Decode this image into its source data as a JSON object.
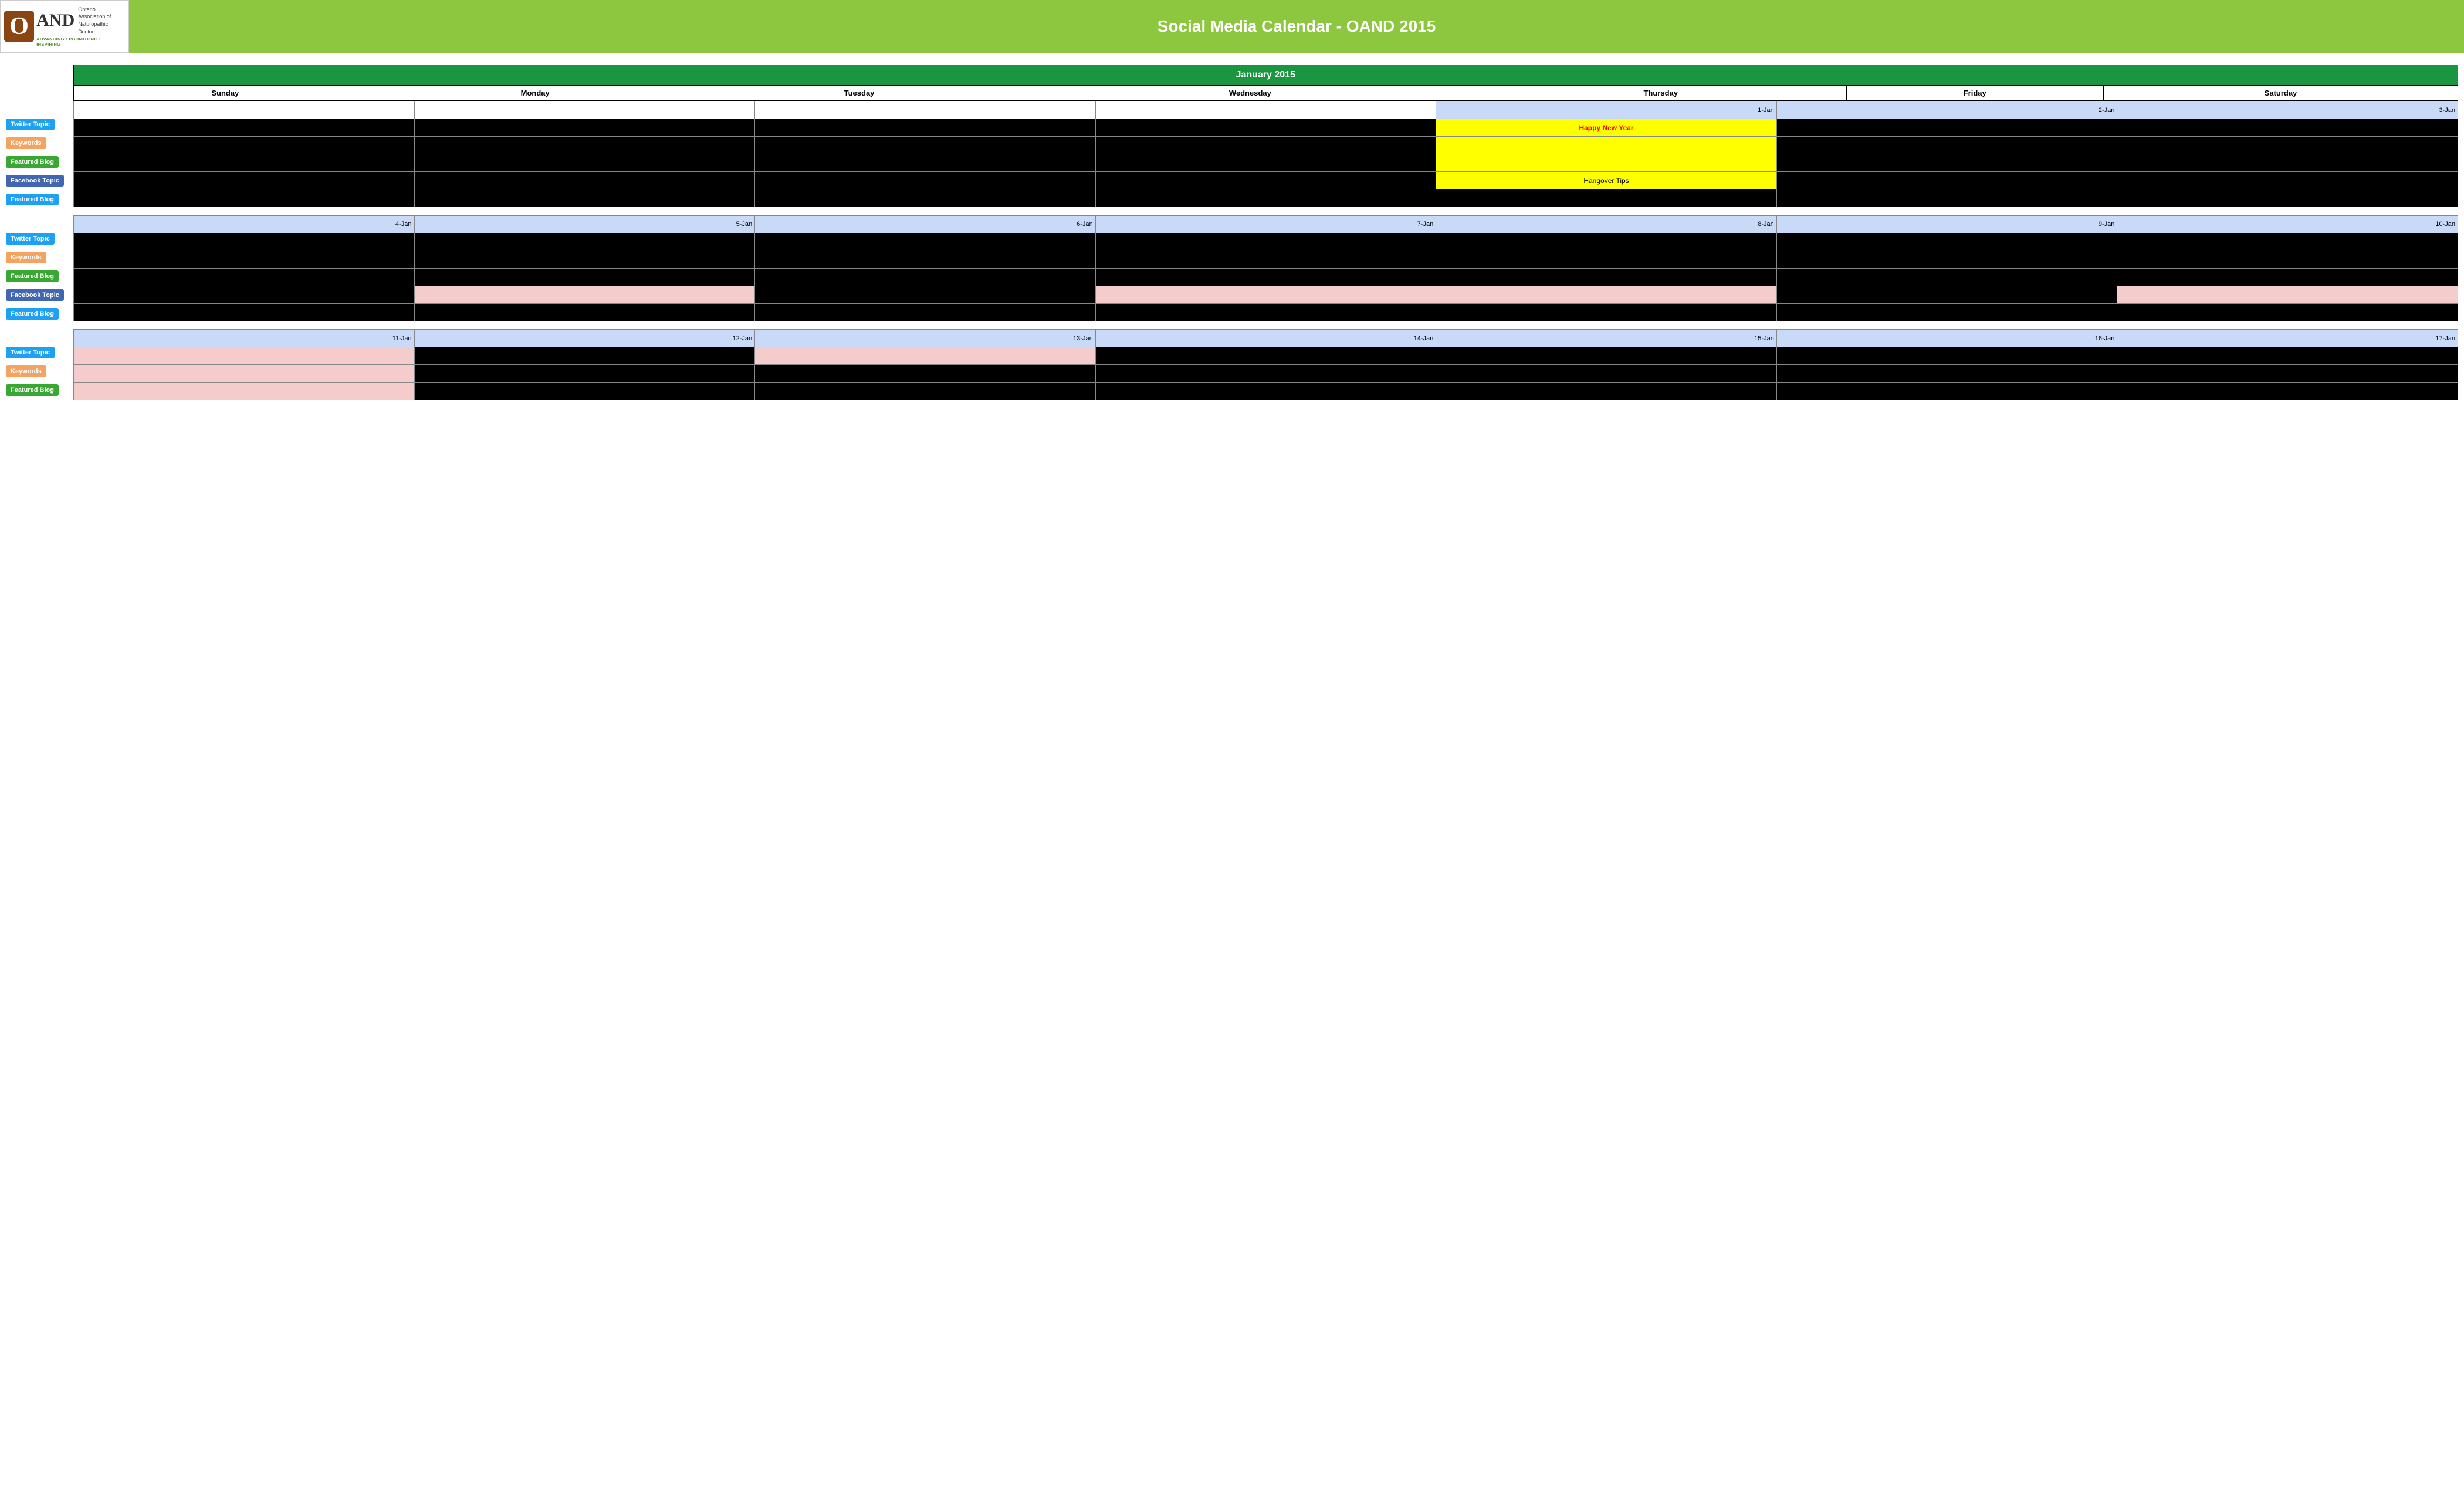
{
  "header": {
    "logo": {
      "o_letter": "O",
      "and_text": "AND",
      "side_text_line1": "Ontario",
      "side_text_line2": "Association of",
      "side_text_line3": "Naturopathic",
      "side_text_line4": "Doctors",
      "tagline": "ADVANCING • PROMOTING • INSPIRING"
    },
    "title": "Social Media Calendar - OAND 2015"
  },
  "calendar": {
    "month": "January 2015",
    "day_headers": [
      "Sunday",
      "Monday",
      "Tuesday",
      "Wednesday",
      "Thursday",
      "Friday",
      "Saturday"
    ],
    "row_labels": {
      "twitter": "Twitter Topic",
      "keywords": "Keywords",
      "featured_blog": "Featured Blog",
      "facebook": "Facebook Topic",
      "featured_blog2": "Featured Blog"
    },
    "week1": {
      "dates": [
        "",
        "",
        "",
        "",
        "1-Jan",
        "2-Jan",
        "3-Jan"
      ],
      "twitter_content": [
        "",
        "",
        "",
        "",
        "Happy New Year",
        "",
        ""
      ],
      "facebook_content": [
        "",
        "",
        "",
        "",
        "Hangover Tips",
        "",
        ""
      ]
    },
    "week2": {
      "dates": [
        "4-Jan",
        "5-Jan",
        "6-Jan",
        "7-Jan",
        "8-Jan",
        "9-Jan",
        "10-Jan"
      ],
      "facebook_content": [
        "",
        "pink",
        "",
        "pink",
        "pink",
        "",
        "pink"
      ]
    },
    "week3": {
      "dates": [
        "11-Jan",
        "12-Jan",
        "13-Jan",
        "14-Jan",
        "15-Jan",
        "16-Jan",
        "17-Jan"
      ],
      "twitter_content": [
        "pink",
        "",
        "pink",
        "",
        "",
        "",
        ""
      ],
      "keywords_content": [
        "pink",
        "",
        "",
        "",
        "",
        "",
        ""
      ],
      "featured_content": [
        "pink",
        "",
        "",
        "",
        "",
        "",
        ""
      ]
    }
  }
}
